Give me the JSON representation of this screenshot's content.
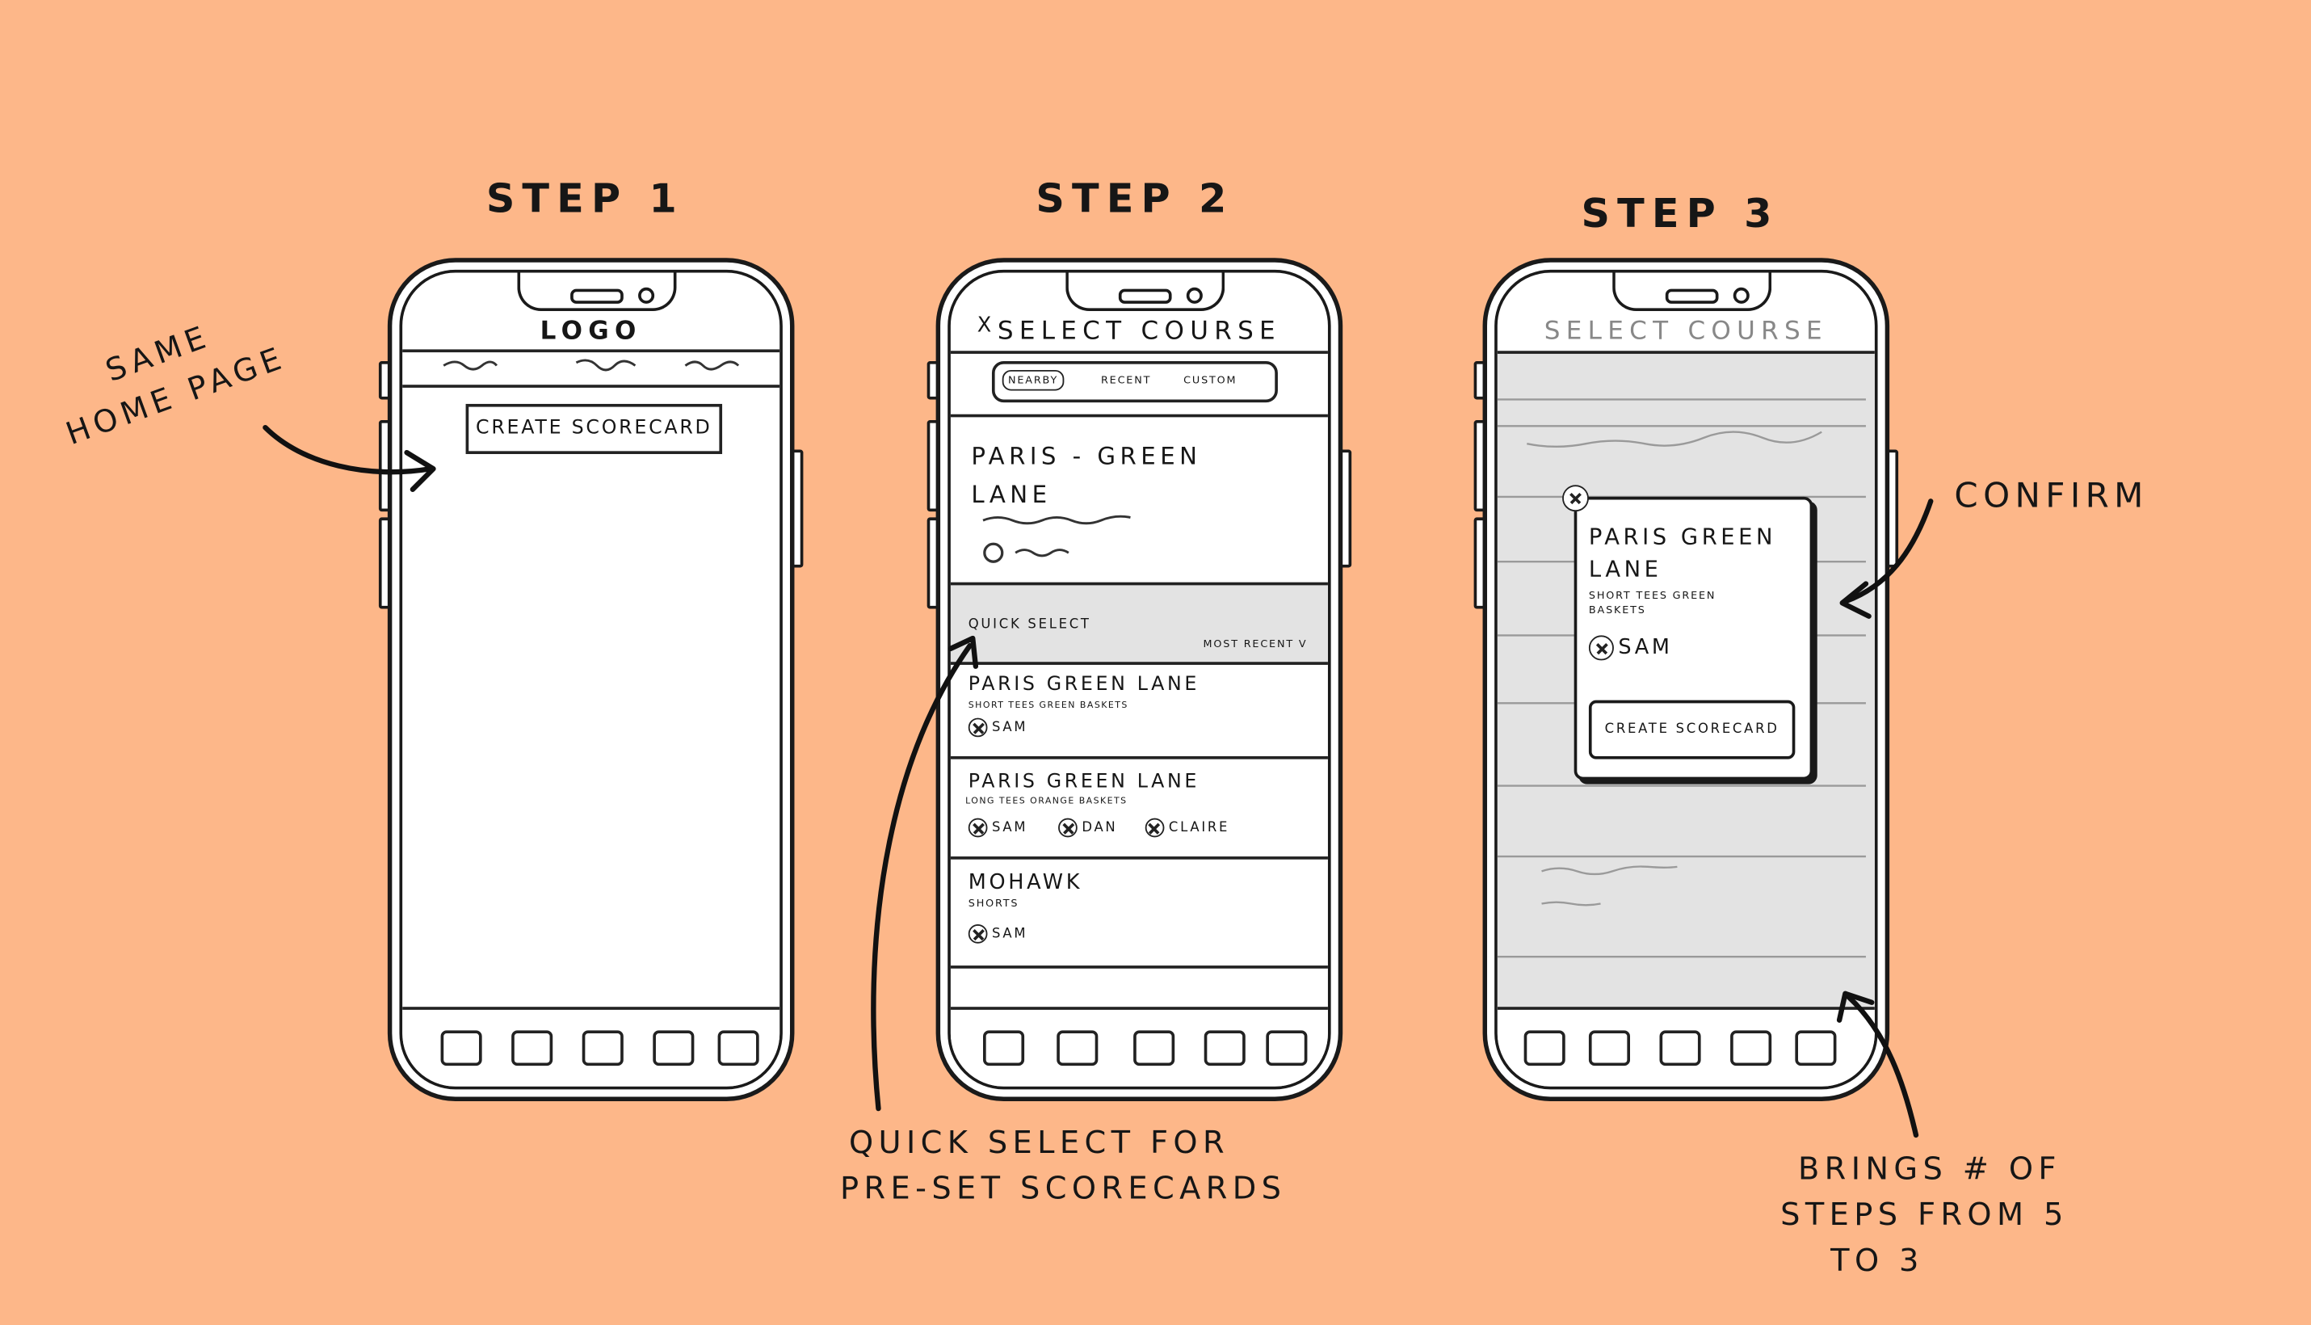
{
  "steps": [
    {
      "title": "STEP 1"
    },
    {
      "title": "STEP 2"
    },
    {
      "title": "STEP 3"
    }
  ],
  "annotations": {
    "same_home": [
      "SAME",
      "HOME PAGE"
    ],
    "quick_select": [
      "QUICK SELECT FOR",
      "PRE-SET SCORECARDS"
    ],
    "confirm": "CONFIRM",
    "brings_steps": [
      "BRINGS # OF",
      "STEPS FROM 5",
      "TO 3"
    ]
  },
  "phone1": {
    "logo": "LOGO",
    "create_button": "CREATE SCORECARD"
  },
  "phone2": {
    "close": "X",
    "title": "SELECT COURSE",
    "tabs": [
      "NEARBY",
      "RECENT",
      "CUSTOM"
    ],
    "featured": {
      "name_line1": "PARIS - GREEN",
      "name_line2": "LANE"
    },
    "quick_select_label": "QUICK SELECT",
    "sort_label": "MOST RECENT V",
    "items": [
      {
        "name": "PARIS GREEN LANE",
        "detail": "SHORT TEES GREEN BASKETS",
        "players": [
          "SAM"
        ]
      },
      {
        "name": "PARIS GREEN LANE",
        "detail": "LONG TEES ORANGE BASKETS",
        "players": [
          "SAM",
          "DAN",
          "CLAIRE"
        ]
      },
      {
        "name": "MOHAWK",
        "detail": "SHORTS",
        "players": [
          "SAM"
        ]
      }
    ]
  },
  "phone3": {
    "title": "SELECT COURSE",
    "modal": {
      "name_line1": "PARIS GREEN",
      "name_line2": "LANE",
      "detail_line1": "SHORT TEES GREEN",
      "detail_line2": "BASKETS",
      "player": "SAM",
      "button": "CREATE SCORECARD"
    }
  }
}
